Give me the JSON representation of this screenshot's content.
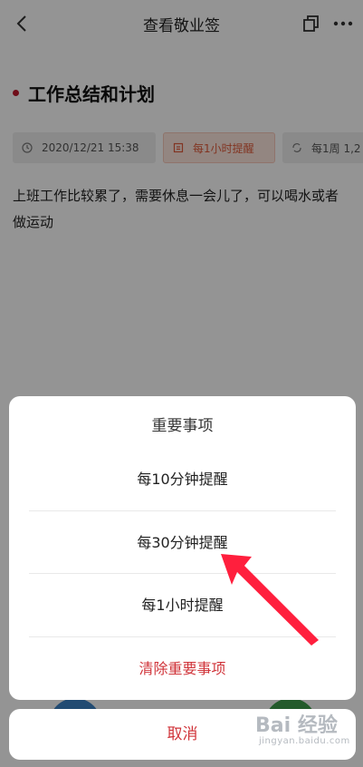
{
  "header": {
    "title": "查看敬业签",
    "back_icon": "chevron-left-icon",
    "copy_icon": "copy-icon",
    "more_icon": "more-icon"
  },
  "note": {
    "title": "工作总结和计划",
    "chips": {
      "date": "2020/12/21 15:38",
      "remind": "每1小时提醒",
      "week": "每1周 1,2"
    },
    "body": "上班工作比较累了，需要休息一会儿了，可以喝水或者做运动"
  },
  "sheet": {
    "title": "重要事项",
    "options": [
      "每10分钟提醒",
      "每30分钟提醒",
      "每1小时提醒"
    ],
    "clear_label": "清除重要事项",
    "cancel_label": "取消"
  },
  "watermark": {
    "logo_text": "Bai 经验",
    "sub_text": "jingyan.baidu.com"
  },
  "colors": {
    "accent_red": "#d0343a",
    "title_dot": "#c0182c",
    "remind_chip_bg": "#fde7df",
    "arrow": "#ff1f3d"
  }
}
